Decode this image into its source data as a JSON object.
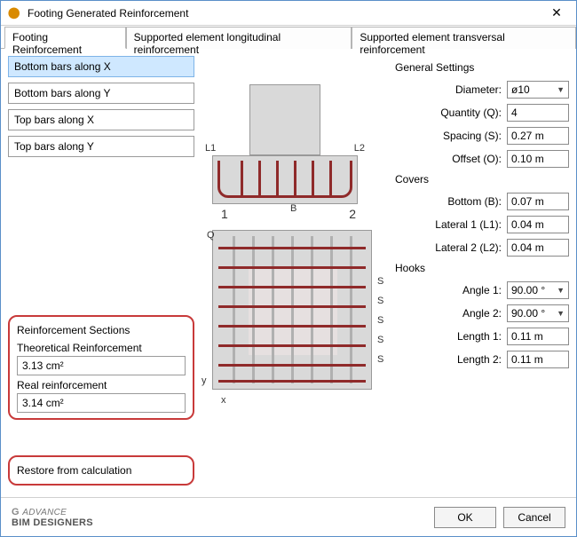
{
  "window": {
    "title": "Footing Generated Reinforcement"
  },
  "tabs": {
    "footing": "Footing Reinforcement",
    "longitudinal": "Supported element longitudinal reinforcement",
    "transversal": "Supported element transversal reinforcement"
  },
  "options": {
    "bottomX": "Bottom bars along X",
    "bottomY": "Bottom bars along Y",
    "topX": "Top bars along X",
    "topY": "Top bars along Y"
  },
  "sections": {
    "title": "Reinforcement Sections",
    "theoretical_label": "Theoretical Reinforcement",
    "theoretical_value": "3.13 cm²",
    "real_label": "Real reinforcement",
    "real_value": "3.14 cm²"
  },
  "restore": "Restore from calculation",
  "diagram": {
    "L1": "L1",
    "L2": "L2",
    "B": "B",
    "one": "1",
    "two": "2",
    "Q": "Q",
    "S": "S",
    "x": "x",
    "y": "y"
  },
  "general": {
    "title": "General Settings",
    "diameter_label": "Diameter:",
    "diameter_value": "ø10",
    "quantity_label": "Quantity (Q):",
    "quantity_value": "4",
    "spacing_label": "Spacing (S):",
    "spacing_value": "0.27 m",
    "offset_label": "Offset (O):",
    "offset_value": "0.10 m"
  },
  "covers": {
    "title": "Covers",
    "bottom_label": "Bottom (B):",
    "bottom_value": "0.07 m",
    "l1_label": "Lateral 1 (L1):",
    "l1_value": "0.04 m",
    "l2_label": "Lateral 2 (L2):",
    "l2_value": "0.04 m"
  },
  "hooks": {
    "title": "Hooks",
    "a1_label": "Angle 1:",
    "a1_value": "90.00 °",
    "a2_label": "Angle 2:",
    "a2_value": "90.00 °",
    "len1_label": "Length 1:",
    "len1_value": "0.11 m",
    "len2_label": "Length 2:",
    "len2_value": "0.11 m"
  },
  "footer": {
    "logo_top": "ADVANCE",
    "logo_main": "BIM DESIGNERS",
    "ok": "OK",
    "cancel": "Cancel"
  }
}
